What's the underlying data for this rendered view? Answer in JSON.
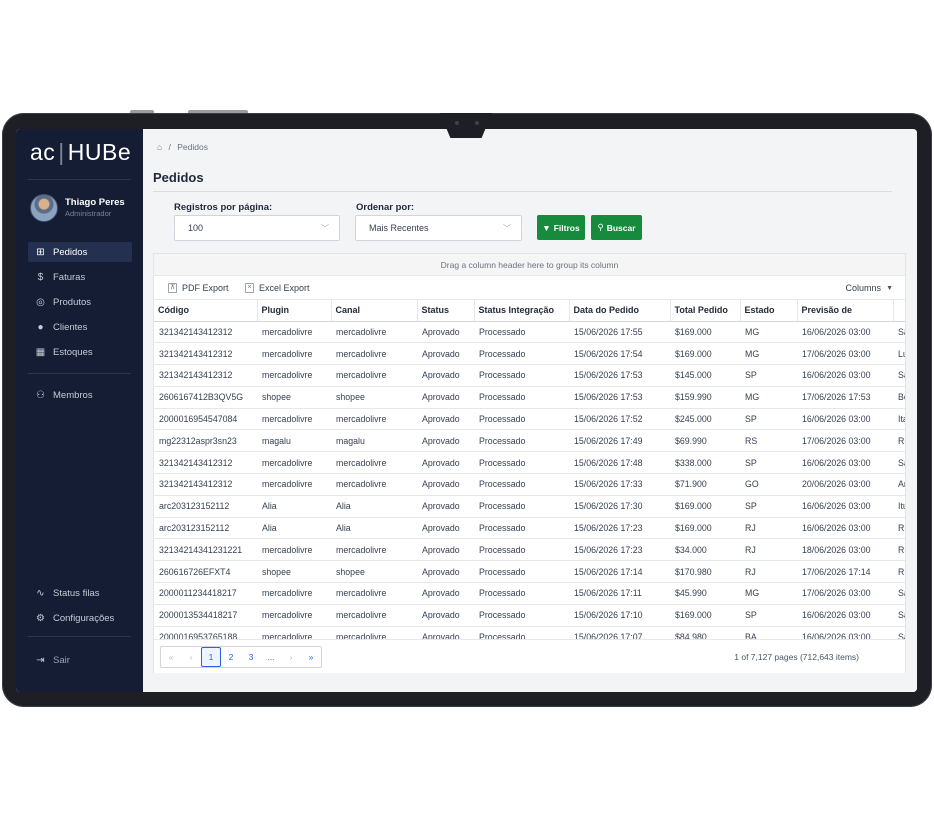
{
  "app": {
    "logo_mark": "ac",
    "logo_text": "HUBe"
  },
  "user": {
    "name": "Thiago Peres",
    "role": "Administrador"
  },
  "nav": [
    {
      "label": "Pedidos",
      "icon": "grid-icon",
      "glyph": "⊞"
    },
    {
      "label": "Faturas",
      "icon": "dollar-icon",
      "glyph": "$"
    },
    {
      "label": "Produtos",
      "icon": "box-scan-icon",
      "glyph": "◎"
    },
    {
      "label": "Clientes",
      "icon": "user-icon",
      "glyph": "●"
    },
    {
      "label": "Estoques",
      "icon": "boxes-icon",
      "glyph": "▦"
    }
  ],
  "nav_members": {
    "label": "Membros",
    "icon": "users-icon",
    "glyph": "⚇"
  },
  "nav_bottom": [
    {
      "label": "Status filas",
      "icon": "activity-icon",
      "glyph": "∿"
    },
    {
      "label": "Configurações",
      "icon": "gear-icon",
      "glyph": "⚙"
    }
  ],
  "logout": {
    "label": "Sair",
    "glyph": "⇥"
  },
  "breadcrumb": {
    "home_glyph": "⌂",
    "sep": "/",
    "current": "Pedidos"
  },
  "page_title": "Pedidos",
  "filters": {
    "per_page_label": "Registros por página:",
    "per_page_value": "100",
    "order_label": "Ordenar por:",
    "order_value": "Mais Recentes",
    "filter_button": "Filtros",
    "search_button": "Buscar"
  },
  "grid": {
    "group_hint": "Drag a column header here to group its column",
    "pdf_export": "PDF Export",
    "excel_export": "Excel Export",
    "columns_label": "Columns",
    "headers": [
      "Código",
      "Plugin",
      "Canal",
      "Status",
      "Status Integração",
      "Data do Pedido",
      "Total Pedido",
      "Estado",
      "Previsão de",
      ""
    ],
    "rows": [
      [
        "321342143412312",
        "mercadolivre",
        "mercadolivre",
        "Aprovado",
        "Processado",
        "15/06/2026 17:55",
        "$169.000",
        "MG",
        "16/06/2026 03:00",
        "Sã"
      ],
      [
        "321342143412312",
        "mercadolivre",
        "mercadolivre",
        "Aprovado",
        "Processado",
        "15/06/2026 17:54",
        "$169.000",
        "MG",
        "17/06/2026 03:00",
        "Lu"
      ],
      [
        "321342143412312",
        "mercadolivre",
        "mercadolivre",
        "Aprovado",
        "Processado",
        "15/06/2026 17:53",
        "$145.000",
        "SP",
        "16/06/2026 03:00",
        "Sã"
      ],
      [
        "2606167412B3QV5G",
        "shopee",
        "shopee",
        "Aprovado",
        "Processado",
        "15/06/2026 17:53",
        "$159.990",
        "MG",
        "17/06/2026 17:53",
        "Be"
      ],
      [
        "2000016954547084",
        "mercadolivre",
        "mercadolivre",
        "Aprovado",
        "Processado",
        "15/06/2026 17:52",
        "$245.000",
        "SP",
        "16/06/2026 03:00",
        "Ita"
      ],
      [
        "mg22312aspr3sn23",
        "magalu",
        "magalu",
        "Aprovado",
        "Processado",
        "15/06/2026 17:49",
        "$69.990",
        "RS",
        "17/06/2026 03:00",
        "Ri"
      ],
      [
        "321342143412312",
        "mercadolivre",
        "mercadolivre",
        "Aprovado",
        "Processado",
        "15/06/2026 17:48",
        "$338.000",
        "SP",
        "16/06/2026 03:00",
        "Sã"
      ],
      [
        "321342143412312",
        "mercadolivre",
        "mercadolivre",
        "Aprovado",
        "Processado",
        "15/06/2026 17:33",
        "$71.900",
        "GO",
        "20/06/2026 03:00",
        "Ar"
      ],
      [
        "arc203123152112",
        "Alia",
        "Alia",
        "Aprovado",
        "Processado",
        "15/06/2026 17:30",
        "$169.000",
        "SP",
        "16/06/2026 03:00",
        "Itu"
      ],
      [
        "arc203123152112",
        "Alia",
        "Alia",
        "Aprovado",
        "Processado",
        "15/06/2026 17:23",
        "$169.000",
        "RJ",
        "16/06/2026 03:00",
        "Ri"
      ],
      [
        "32134214341231221",
        "mercadolivre",
        "mercadolivre",
        "Aprovado",
        "Processado",
        "15/06/2026 17:23",
        "$34.000",
        "RJ",
        "18/06/2026 03:00",
        "Ri"
      ],
      [
        "260616726EFXT4",
        "shopee",
        "shopee",
        "Aprovado",
        "Processado",
        "15/06/2026 17:14",
        "$170.980",
        "RJ",
        "17/06/2026 17:14",
        "Ri"
      ],
      [
        "2000011234418217",
        "mercadolivre",
        "mercadolivre",
        "Aprovado",
        "Processado",
        "15/06/2026 17:11",
        "$45.990",
        "MG",
        "17/06/2026 03:00",
        "Sa"
      ],
      [
        "2000013534418217",
        "mercadolivre",
        "mercadolivre",
        "Aprovado",
        "Processado",
        "15/06/2026 17:10",
        "$169.000",
        "SP",
        "16/06/2026 03:00",
        "Sã"
      ],
      [
        "2000016953765188",
        "mercadolivre",
        "mercadolivre",
        "Aprovado",
        "Processado",
        "15/06/2026 17:07",
        "$84.980",
        "BA",
        "16/06/2026 03:00",
        "Sa"
      ]
    ]
  },
  "pager": {
    "first": "«",
    "prev": "‹",
    "pages": [
      "1",
      "2",
      "3",
      "..."
    ],
    "next": "›",
    "last": "»",
    "info": "1 of 7,127 pages (712,643 items)"
  }
}
